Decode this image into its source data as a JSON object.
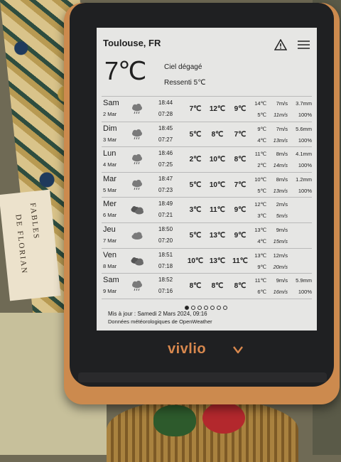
{
  "book": {
    "line1": "FABLES",
    "line2": "DE FLORIAN"
  },
  "device": {
    "brand": "vivlio"
  },
  "header": {
    "location": "Toulouse, FR"
  },
  "current": {
    "temperature": "7℃",
    "condition": "Ciel dégagé",
    "feels_like": "Ressenti 5℃"
  },
  "forecast": [
    {
      "day": "Sam",
      "date": "2 Mar",
      "icon": "rain-cloud-icon",
      "sunset": "18:44",
      "sunrise": "07:28",
      "t_morning": "7℃",
      "t_day": "12℃",
      "t_evening": "9℃",
      "t_max": "14℃",
      "t_min": "5℃",
      "wind": "7m/s",
      "gust": "11m/s",
      "rain": "3.7mm",
      "prob": "100%"
    },
    {
      "day": "Dim",
      "date": "3 Mar",
      "icon": "rain-cloud-icon",
      "sunset": "18:45",
      "sunrise": "07:27",
      "t_morning": "5℃",
      "t_day": "8℃",
      "t_evening": "7℃",
      "t_max": "9℃",
      "t_min": "4℃",
      "wind": "7m/s",
      "gust": "13m/s",
      "rain": "5.6mm",
      "prob": "100%"
    },
    {
      "day": "Lun",
      "date": "4 Mar",
      "icon": "rain-cloud-icon",
      "sunset": "18:46",
      "sunrise": "07:25",
      "t_morning": "2℃",
      "t_day": "10℃",
      "t_evening": "8℃",
      "t_max": "11℃",
      "t_min": "2℃",
      "wind": "8m/s",
      "gust": "14m/s",
      "rain": "4.1mm",
      "prob": "100%"
    },
    {
      "day": "Mar",
      "date": "5 Mar",
      "icon": "rain-cloud-icon",
      "sunset": "18:47",
      "sunrise": "07:23",
      "t_morning": "5℃",
      "t_day": "10℃",
      "t_evening": "7℃",
      "t_max": "10℃",
      "t_min": "5℃",
      "wind": "8m/s",
      "gust": "13m/s",
      "rain": "1.2mm",
      "prob": "100%"
    },
    {
      "day": "Mer",
      "date": "6 Mar",
      "icon": "clouds-icon",
      "sunset": "18:49",
      "sunrise": "07:21",
      "t_morning": "3℃",
      "t_day": "11℃",
      "t_evening": "9℃",
      "t_max": "12℃",
      "t_min": "3℃",
      "wind": "2m/s",
      "gust": "5m/s",
      "rain": "",
      "prob": ""
    },
    {
      "day": "Jeu",
      "date": "7 Mar",
      "icon": "cloud-icon",
      "sunset": "18:50",
      "sunrise": "07:20",
      "t_morning": "5℃",
      "t_day": "13℃",
      "t_evening": "9℃",
      "t_max": "13℃",
      "t_min": "4℃",
      "wind": "9m/s",
      "gust": "15m/s",
      "rain": "",
      "prob": ""
    },
    {
      "day": "Ven",
      "date": "8 Mar",
      "icon": "clouds-icon",
      "sunset": "18:51",
      "sunrise": "07:18",
      "t_morning": "10℃",
      "t_day": "13℃",
      "t_evening": "11℃",
      "t_max": "13℃",
      "t_min": "9℃",
      "wind": "12m/s",
      "gust": "20m/s",
      "rain": "",
      "prob": ""
    },
    {
      "day": "Sam",
      "date": "9 Mar",
      "icon": "rain-cloud-icon",
      "sunset": "18:52",
      "sunrise": "07:16",
      "t_morning": "8℃",
      "t_day": "8℃",
      "t_evening": "8℃",
      "t_max": "11℃",
      "t_min": "6℃",
      "wind": "9m/s",
      "gust": "16m/s",
      "rain": "5.9mm",
      "prob": "100%"
    }
  ],
  "pagination": {
    "pages": 7,
    "active": 1
  },
  "footer": {
    "updated": "Mis à jour : Samedi 2 Mars 2024, 09:16",
    "source": "Données météorologiques de OpenWeather"
  }
}
